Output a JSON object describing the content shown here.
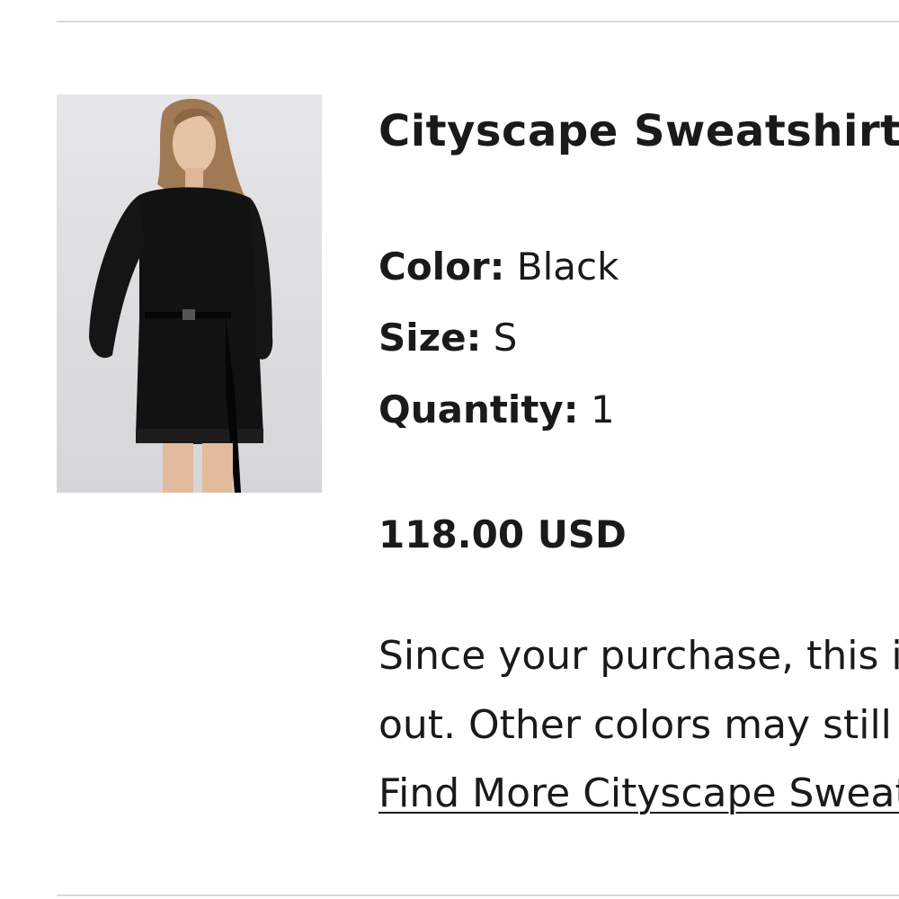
{
  "product": {
    "name": "Cityscape Sweatshirt",
    "color_label": "Color:",
    "color_value": "Black",
    "size_label": "Size:",
    "size_value": "S",
    "quantity_label": "Quantity:",
    "quantity_value": "1",
    "price": "118.00 USD"
  },
  "notice": {
    "line1": "Since your purchase, this item has sold",
    "line2": "out. Other colors may still be available.",
    "link": "Find More Cityscape Sweatshirts"
  },
  "colors": {
    "text": "#1a1a1a",
    "divider": "#d9d9d9",
    "image_bg": "#dcdcdf"
  }
}
